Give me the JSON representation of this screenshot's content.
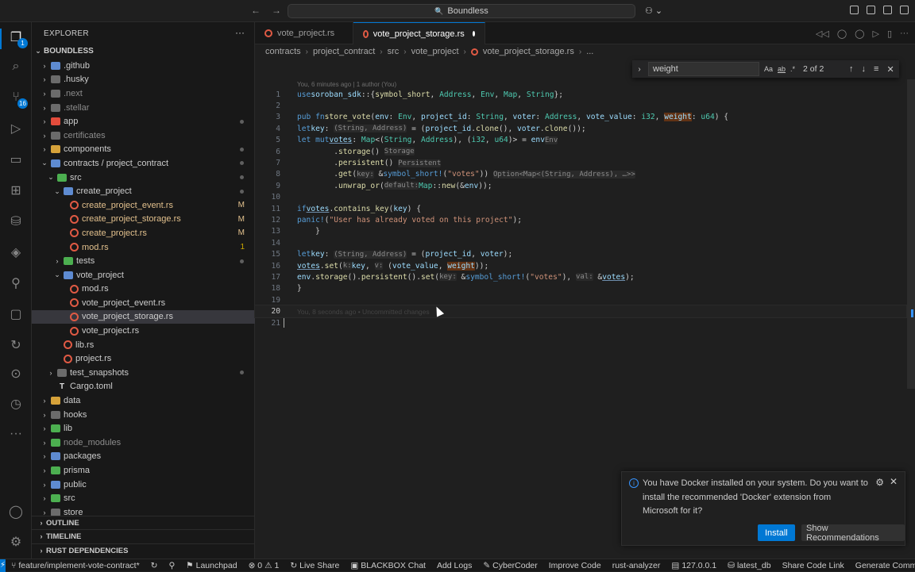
{
  "titlebar": {
    "back": "←",
    "forward": "→",
    "search_icon": "🔍",
    "search_text": "Boundless",
    "copilot": "⚇ ⌄"
  },
  "activity": {
    "explorer_badge": "1",
    "scm_badge": "16"
  },
  "explorer": {
    "title": "EXPLORER",
    "more": "···",
    "root": "BOUNDLESS",
    "items": [
      {
        "indent": 1,
        "type": "folder",
        "chev": "›",
        "label": ".github",
        "color": "#5e8bd1"
      },
      {
        "indent": 1,
        "type": "folder",
        "chev": "›",
        "label": ".husky",
        "color": "#6b6b6b"
      },
      {
        "indent": 1,
        "type": "folder",
        "chev": "›",
        "label": ".next",
        "color": "#6b6b6b",
        "dim": true
      },
      {
        "indent": 1,
        "type": "folder",
        "chev": "›",
        "label": ".stellar",
        "color": "#6b6b6b",
        "dim": true
      },
      {
        "indent": 1,
        "type": "folder",
        "chev": "›",
        "label": "app",
        "color": "#e34c3c",
        "dot": true
      },
      {
        "indent": 1,
        "type": "folder",
        "chev": "›",
        "label": "certificates",
        "color": "#6b6b6b",
        "dim": true
      },
      {
        "indent": 1,
        "type": "folder",
        "chev": "›",
        "label": "components",
        "color": "#d6a23a",
        "dot": true
      },
      {
        "indent": 1,
        "type": "folder",
        "chev": "⌄",
        "label": "contracts / project_contract",
        "color": "#5e8bd1",
        "dot": true
      },
      {
        "indent": 2,
        "type": "folder",
        "chev": "⌄",
        "label": "src",
        "color": "#4caf50",
        "dot": true
      },
      {
        "indent": 3,
        "type": "folder",
        "chev": "⌄",
        "label": "create_project",
        "color": "#5e8bd1",
        "dot": true
      },
      {
        "indent": 4,
        "type": "rs",
        "chev": "",
        "label": "create_project_event.rs",
        "status": "M"
      },
      {
        "indent": 4,
        "type": "rs",
        "chev": "",
        "label": "create_project_storage.rs",
        "status": "M"
      },
      {
        "indent": 4,
        "type": "rs",
        "chev": "",
        "label": "create_project.rs",
        "status": "M"
      },
      {
        "indent": 4,
        "type": "rs",
        "chev": "",
        "label": "mod.rs",
        "status": "1"
      },
      {
        "indent": 3,
        "type": "folder",
        "chev": "›",
        "label": "tests",
        "color": "#4caf50",
        "dot": true
      },
      {
        "indent": 3,
        "type": "folder",
        "chev": "⌄",
        "label": "vote_project",
        "color": "#5e8bd1"
      },
      {
        "indent": 4,
        "type": "rs",
        "chev": "",
        "label": "mod.rs"
      },
      {
        "indent": 4,
        "type": "rs",
        "chev": "",
        "label": "vote_project_event.rs"
      },
      {
        "indent": 4,
        "type": "rs",
        "chev": "",
        "label": "vote_project_storage.rs",
        "selected": true
      },
      {
        "indent": 4,
        "type": "rs",
        "chev": "",
        "label": "vote_project.rs"
      },
      {
        "indent": 3,
        "type": "rs",
        "chev": "",
        "label": "lib.rs"
      },
      {
        "indent": 3,
        "type": "rs",
        "chev": "",
        "label": "project.rs"
      },
      {
        "indent": 2,
        "type": "folder",
        "chev": "›",
        "label": "test_snapshots",
        "color": "#6b6b6b",
        "dot": true
      },
      {
        "indent": 2,
        "type": "toml",
        "chev": "",
        "label": "Cargo.toml"
      },
      {
        "indent": 1,
        "type": "folder",
        "chev": "›",
        "label": "data",
        "color": "#d6a23a"
      },
      {
        "indent": 1,
        "type": "folder",
        "chev": "›",
        "label": "hooks",
        "color": "#6b6b6b"
      },
      {
        "indent": 1,
        "type": "folder",
        "chev": "›",
        "label": "lib",
        "color": "#4caf50"
      },
      {
        "indent": 1,
        "type": "folder",
        "chev": "›",
        "label": "node_modules",
        "color": "#4caf50",
        "dim": true
      },
      {
        "indent": 1,
        "type": "folder",
        "chev": "›",
        "label": "packages",
        "color": "#5e8bd1"
      },
      {
        "indent": 1,
        "type": "folder",
        "chev": "›",
        "label": "prisma",
        "color": "#4caf50"
      },
      {
        "indent": 1,
        "type": "folder",
        "chev": "›",
        "label": "public",
        "color": "#5e8bd1"
      },
      {
        "indent": 1,
        "type": "folder",
        "chev": "›",
        "label": "src",
        "color": "#4caf50"
      },
      {
        "indent": 1,
        "type": "folder",
        "chev": "›",
        "label": "store",
        "color": "#6b6b6b"
      }
    ],
    "sections": [
      "OUTLINE",
      "TIMELINE",
      "RUST DEPENDENCIES"
    ]
  },
  "tabs": [
    {
      "label": "vote_project.rs",
      "active": false
    },
    {
      "label": "vote_project_storage.rs",
      "active": true,
      "dirty": true
    }
  ],
  "breadcrumb": [
    "contracts",
    "project_contract",
    "src",
    "vote_project",
    "vote_project_storage.rs",
    "..."
  ],
  "find": {
    "query": "weight",
    "opts": [
      "Aa",
      "ab",
      ".*"
    ],
    "count": "2 of 2",
    "prev": "↑",
    "next": "↓",
    "menu": "≡",
    "close": "✕",
    "toggle": "›"
  },
  "code": {
    "blame": "You, 6 minutes ago | 1 author (You)",
    "ghost": "You, 8 seconds ago • Uncommitted changes",
    "current_line": 20
  },
  "toast": {
    "message": "You have Docker installed on your system. Do you want to install the recommended 'Docker' extension from Microsoft for it?",
    "install": "Install",
    "recommendations": "Show Recommendations",
    "gear": "⚙",
    "close": "✕"
  },
  "statusbar": {
    "remote": "⚡",
    "branch": "feature/implement-vote-contract*",
    "sync": "↻",
    "launchpad": "Launchpad",
    "errors": "⊗ 0",
    "warnings": "⚠ 1",
    "liveshare": "Live Share",
    "blackbox": "BLACKBOX Chat",
    "addlogs": "Add Logs",
    "cybercoder": "CyberCoder",
    "improve": "Improve Code",
    "analyzer": "rust-analyzer",
    "host": "127.0.0.1",
    "db": "latest_db",
    "share": "Share Code Link",
    "commit": "Generate Commit"
  }
}
